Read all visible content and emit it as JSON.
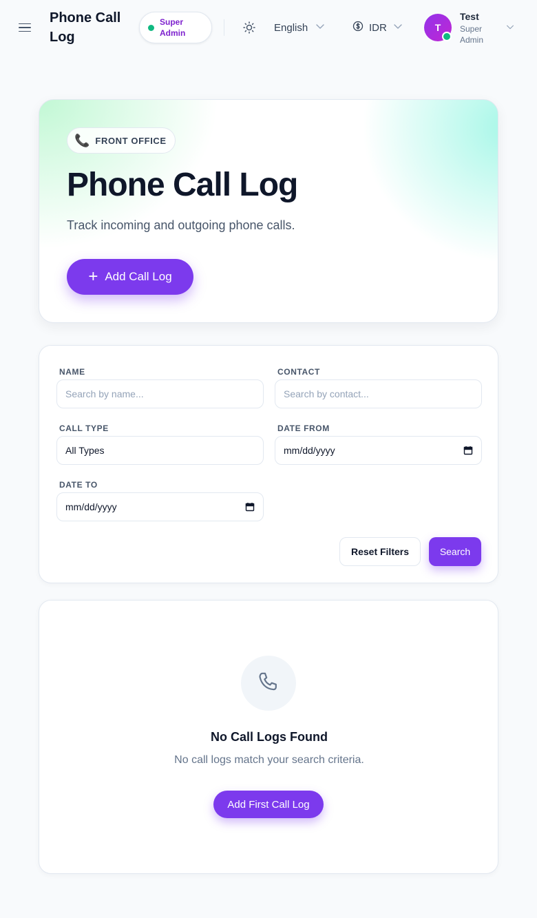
{
  "header": {
    "title": "Phone Call Log",
    "role_badge": "Super Admin",
    "language": "English",
    "currency": "IDR",
    "user": {
      "initial": "T",
      "name": "Test",
      "role": "Super Admin"
    }
  },
  "hero": {
    "badge": "FRONT OFFICE",
    "title": "Phone Call Log",
    "subtitle": "Track incoming and outgoing phone calls.",
    "add_button": "Add Call Log"
  },
  "filters": {
    "name": {
      "label": "NAME",
      "placeholder": "Search by name..."
    },
    "contact": {
      "label": "CONTACT",
      "placeholder": "Search by contact..."
    },
    "call_type": {
      "label": "CALL TYPE",
      "value": "All Types"
    },
    "date_from": {
      "label": "DATE FROM",
      "value": "mm/dd/yyyy"
    },
    "date_to": {
      "label": "DATE TO",
      "value": "mm/dd/yyyy"
    },
    "reset_button": "Reset Filters",
    "search_button": "Search"
  },
  "empty_state": {
    "title": "No Call Logs Found",
    "message": "No call logs match your search criteria.",
    "button": "Add First Call Log"
  },
  "colors": {
    "accent": "#7c3aed",
    "online": "#10b981",
    "role_text": "#7e22ce"
  }
}
